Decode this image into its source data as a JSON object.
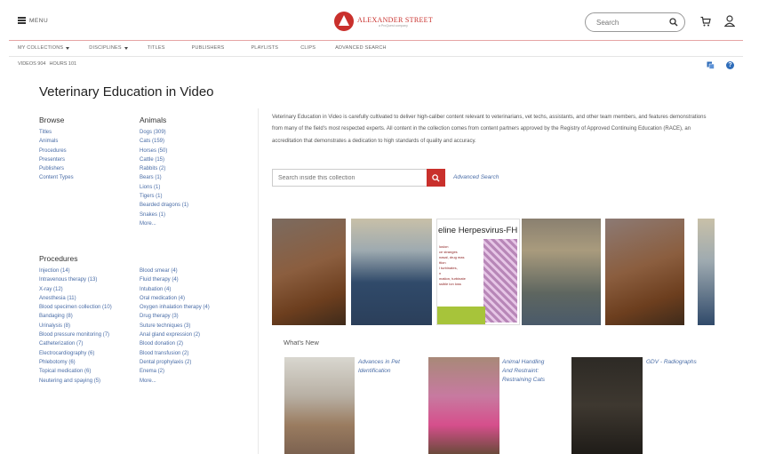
{
  "header": {
    "menu_label": "MENU",
    "logo_name": "ALEXANDER STREET",
    "logo_sub": "a ProQuest company",
    "search_placeholder": "Search"
  },
  "nav": [
    {
      "label": "MY COLLECTIONS",
      "dropdown": true
    },
    {
      "label": "DISCIPLINES",
      "dropdown": true
    },
    {
      "label": "TITLES",
      "dropdown": false
    },
    {
      "label": "PUBLISHERS",
      "dropdown": false
    },
    {
      "label": "PLAYLISTS",
      "dropdown": false
    },
    {
      "label": "CLIPS",
      "dropdown": false
    },
    {
      "label": "ADVANCED SEARCH",
      "dropdown": false
    }
  ],
  "stats": {
    "videos": "VIDEOS 904",
    "hours": "HOURS 101"
  },
  "page_title": "Veterinary Education in Video",
  "browse": {
    "heading": "Browse",
    "items": [
      "Titles",
      "Animals",
      "Procedures",
      "Presenters",
      "Publishers",
      "Content Types"
    ]
  },
  "animals": {
    "heading": "Animals",
    "items": [
      "Dogs (309)",
      "Cats (159)",
      "Horses (50)",
      "Cattle (15)",
      "Rabbits (2)",
      "Bears (1)",
      "Lions (1)",
      "Tigers (1)",
      "Bearded dragons (1)",
      "Snakes (1)",
      "More..."
    ]
  },
  "procedures": {
    "heading": "Procedures",
    "col1": [
      "Injection (14)",
      "Intravenous therapy (13)",
      "X-ray (12)",
      "Anesthesia (11)",
      "Blood specimen collection (10)",
      "Bandaging (8)",
      "Urinalysis (8)",
      "Blood pressure monitoring (7)",
      "Catheterization (7)",
      "Electrocardiography (6)",
      "Phlebotomy (6)",
      "Topical medication (6)",
      "Neutering and spaying (5)"
    ],
    "col2": [
      "Blood smear (4)",
      "Fluid therapy (4)",
      "Intubation (4)",
      "Oral medication (4)",
      "Oxygen inhalation therapy (4)",
      "Drug therapy (3)",
      "Suture techniques (3)",
      "Anal gland expression (2)",
      "Blood donation (2)",
      "Blood transfusion (2)",
      "Dental prophylaxis (2)",
      "Enema (2)",
      "More..."
    ]
  },
  "description": "Veterinary Education in Video is carefully cultivated to deliver high-caliber content relevant to veterinarians, vet techs, assistants, and other team members, and features demonstrations from many of the field's most respected experts. All content in the collection comes from content partners approved by the Registry of Approved Continuing Education (RACE), an accreditation that demonstrates a dedication to high standards of quality and accuracy.",
  "collection_search": {
    "placeholder": "Search inside this collection",
    "advanced_label": "Advanced Search"
  },
  "carousel": {
    "slide_title": "eline Herpesvirus-FH",
    "slide_lines": [
      "lusion",
      "ce stranges",
      "nasal, drug mas",
      "ttion",
      "l turbinates,",
      "n",
      "mation, turbinate",
      "ssible ion loss"
    ]
  },
  "whats_new": {
    "heading": "What's New",
    "items": [
      "Advances in Pet Identification",
      "Animal Handling And Restraint: Restraining Cats",
      "GDV - Radiographs"
    ]
  },
  "colors": {
    "brand_red": "#c9302c",
    "link_blue": "#4a6da7",
    "help_blue": "#2f6dba"
  }
}
